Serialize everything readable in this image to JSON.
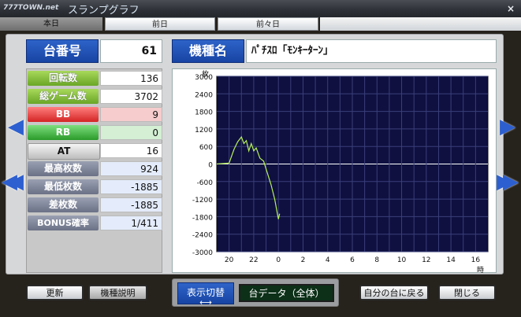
{
  "window": {
    "logo": "777TOWN.net",
    "title": "スランプグラフ",
    "close": "×"
  },
  "tabs": [
    "本日",
    "前日",
    "前々日"
  ],
  "header": {
    "daiban_label": "台番号",
    "daiban_value": "61",
    "kishu_label": "機種名",
    "kishu_value": "ﾊﾟﾁｽﾛ「ﾓﾝｷｰﾀｰﾝ」"
  },
  "stats": [
    {
      "label": "回転数",
      "value": "136"
    },
    {
      "label": "総ゲーム数",
      "value": "3702"
    },
    {
      "label": "BB",
      "value": "9"
    },
    {
      "label": "RB",
      "value": "0"
    },
    {
      "label": "AT",
      "value": "16"
    },
    {
      "label": "最高枚数",
      "value": "924"
    },
    {
      "label": "最低枚数",
      "value": "-1885"
    },
    {
      "label": "差枚数",
      "value": "-1885"
    },
    {
      "label": "BONUS確率",
      "value": "1/411"
    }
  ],
  "nav": {
    "prev": "◀",
    "first": "◀◀",
    "next": "▶",
    "last": "▶▶"
  },
  "buttons": {
    "update": "更新",
    "desc": "機種説明",
    "toggle": "表示切替",
    "toggle_arrow": "⟷",
    "data": "台データ（全体）",
    "back": "自分の台に戻る",
    "close": "閉じる"
  },
  "colors": {
    "chart_bg": "#0f1040",
    "grid": "#3a3f7a",
    "line": "#b6f05a"
  },
  "chart_data": {
    "type": "line",
    "ylabel": "枚",
    "xlabel": "時",
    "ylim": [
      -3000,
      3000
    ],
    "yticks": [
      3000,
      2400,
      1800,
      1200,
      600,
      0,
      -600,
      -1200,
      -1800,
      -2400,
      -3000
    ],
    "xticks": [
      "20",
      "22",
      "0",
      "2",
      "4",
      "6",
      "8",
      "10",
      "12",
      "14",
      "16"
    ],
    "xlim": [
      19,
      41
    ],
    "series": [
      {
        "x": [
          19,
          20,
          20.4,
          20.7,
          21,
          21.2,
          21.4,
          21.6,
          21.8,
          22,
          22.2,
          22.5,
          22.8,
          23.1,
          23.4,
          23.7,
          24,
          24.1
        ],
        "y": [
          0,
          30,
          500,
          760,
          924,
          700,
          800,
          450,
          700,
          450,
          550,
          200,
          100,
          -300,
          -700,
          -1200,
          -1885,
          -1700
        ]
      }
    ]
  }
}
